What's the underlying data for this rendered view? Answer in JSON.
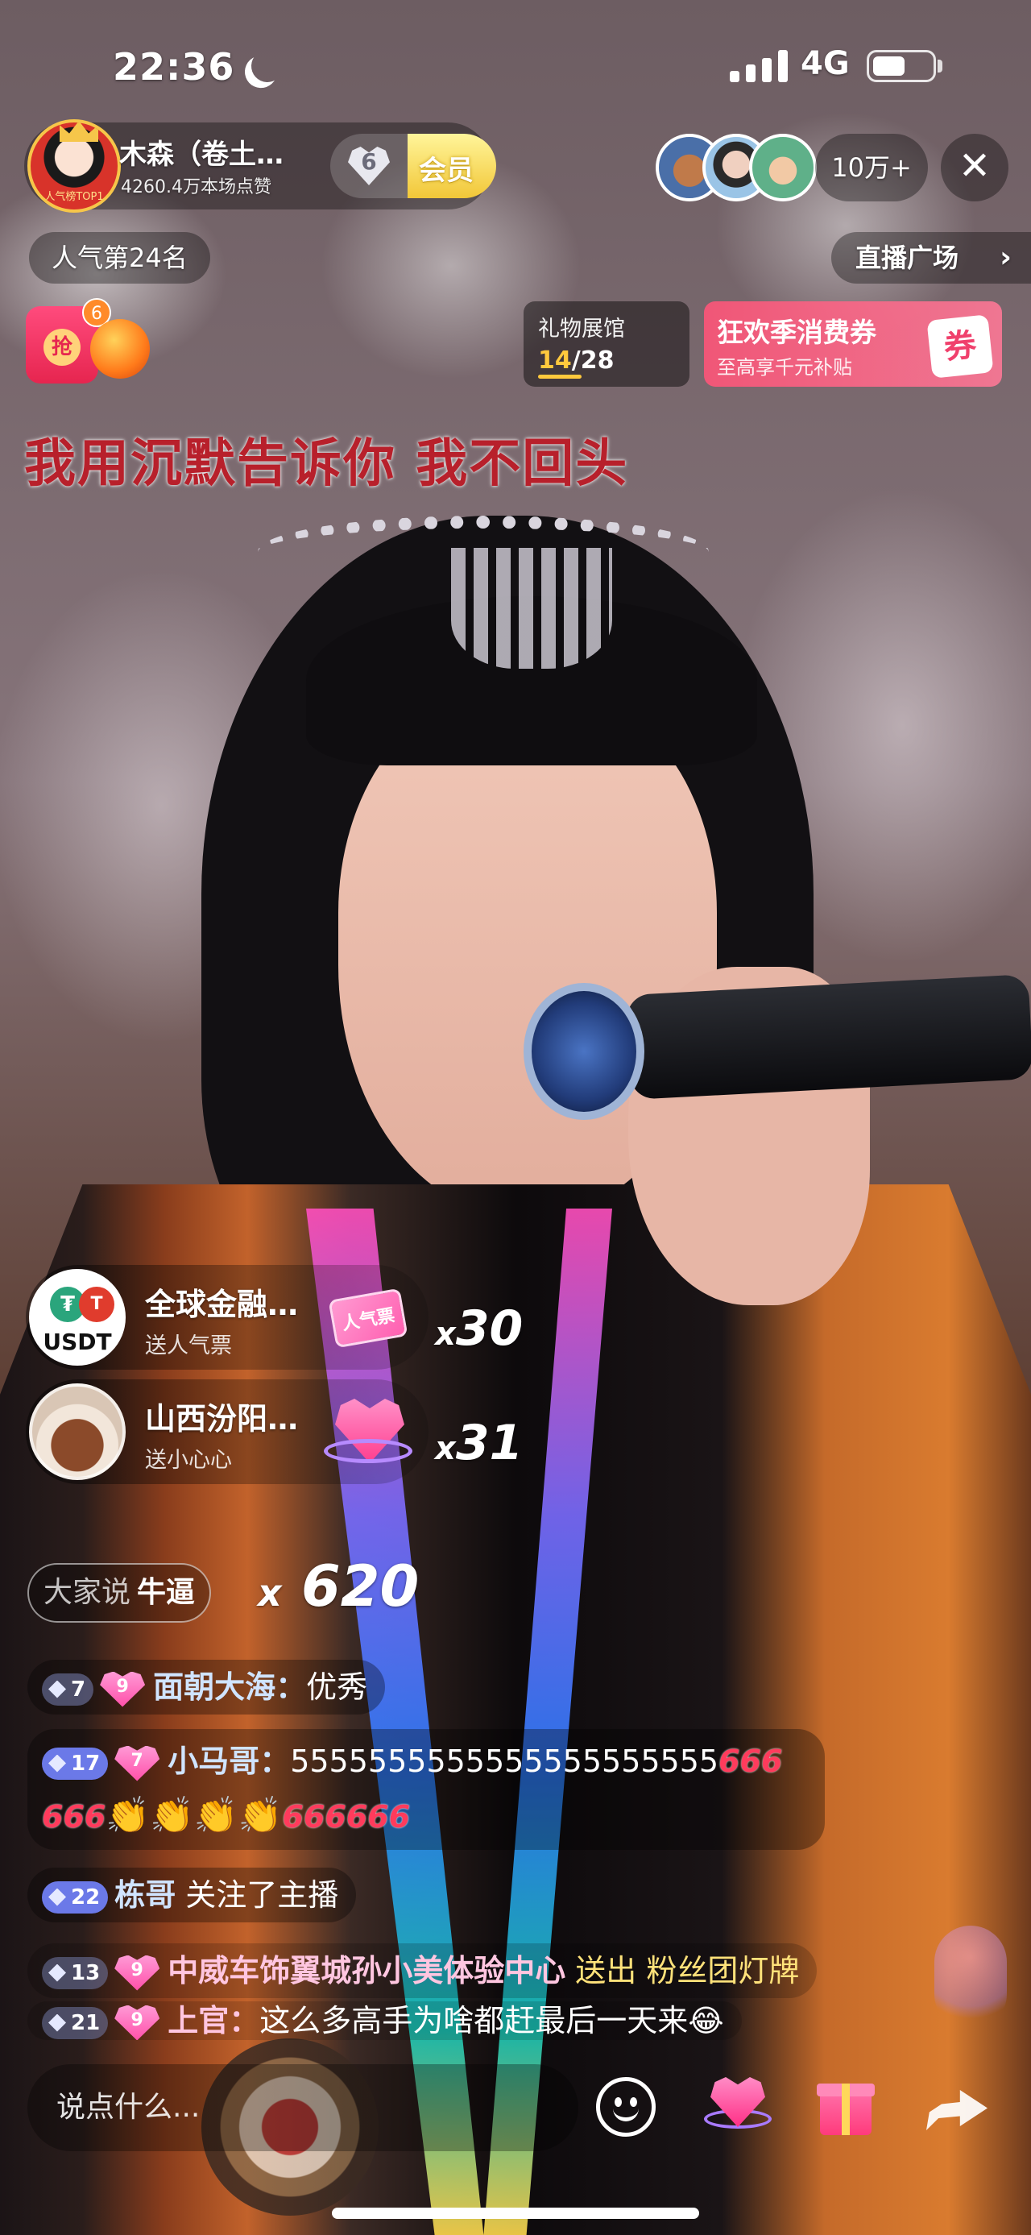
{
  "status_bar": {
    "time": "22:36",
    "network": "4G",
    "battery_level": 0.55
  },
  "host": {
    "name": "木森（卷土…",
    "likes": "4260.4万本场点赞",
    "avatar_label": "人气榜TOP1",
    "fan_level": "6",
    "vip_label": "会员"
  },
  "top_right": {
    "viewer_count": "10万+",
    "close_icon": "close-icon"
  },
  "ranking": {
    "label": "人气第24名"
  },
  "plaza": {
    "label": "直播广场",
    "chevron": "›"
  },
  "red_packet": {
    "count": "6",
    "seal": "抢"
  },
  "gift_gallery": {
    "title": "礼物展馆",
    "current": "14",
    "total": "/28"
  },
  "coupon": {
    "title": "狂欢季消费券",
    "subtitle": "至高享千元补贴",
    "tag": "券"
  },
  "lyric": "我用沉默告诉你  我不回头",
  "gifts": [
    {
      "name": "全球金融…",
      "action": "送人气票",
      "gift_label": "人气票",
      "avatar_label": "USDT",
      "multiplier_x": "x",
      "multiplier": "30"
    },
    {
      "name": "山西汾阳…",
      "action": "送小心心",
      "gift_label": "",
      "multiplier_x": "x",
      "multiplier": "31"
    }
  ],
  "hot_phrase": {
    "lead": "大家说",
    "term": "牛逼",
    "multiplier_x": "x",
    "multiplier": "620"
  },
  "chat": [
    {
      "level": "7",
      "fan_level": "9",
      "user": "面朝大海：",
      "text": "优秀"
    },
    {
      "level": "17",
      "fan_level": "7",
      "user": "小马哥：",
      "text": "5555555555555555555555",
      "emoji_666": "666",
      "clap": "👏"
    },
    {
      "level": "22",
      "user": "栋哥",
      "text": "关注了主播"
    },
    {
      "level": "13",
      "fan_level": "9",
      "user": "中威车饰翼城孙小美体验中心",
      "text_a": "送出",
      "text_b": "粉丝团灯牌"
    },
    {
      "level": "21",
      "fan_level": "9",
      "user": "上官：",
      "text": "这么多高手为啥都赶最后一天来",
      "emoji": "😂"
    }
  ],
  "input": {
    "placeholder": "说点什么..."
  },
  "colors": {
    "accent_pink": "#ff3d8e",
    "gold": "#ffc93d",
    "lyric_red": "#b8202b",
    "coupon_pink": "#fa5578"
  },
  "icons": [
    "moon-icon",
    "signal-icon",
    "battery-icon",
    "close-icon",
    "chevron-right-icon",
    "emoji-icon",
    "heart-icon",
    "gift-icon",
    "share-icon"
  ]
}
